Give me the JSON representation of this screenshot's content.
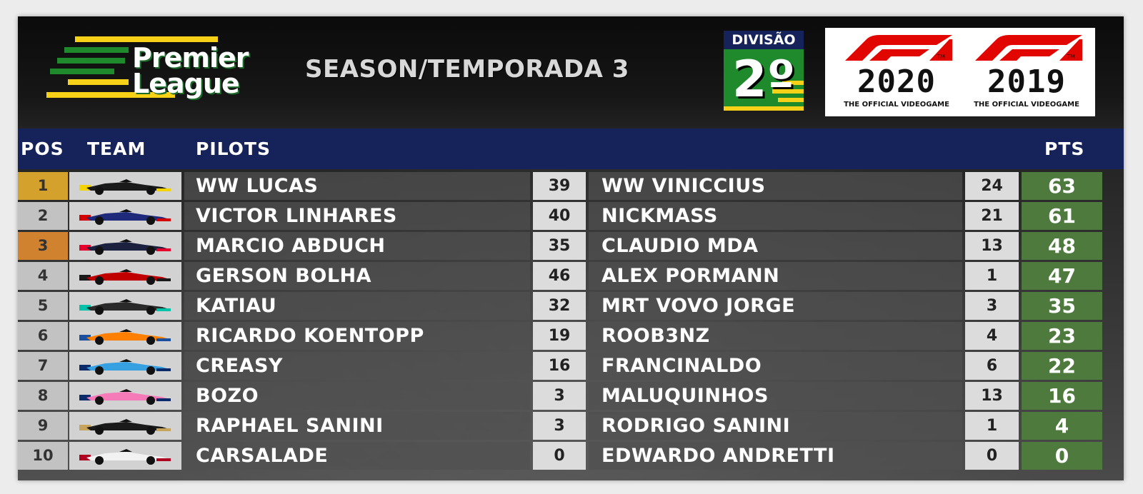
{
  "header": {
    "league_line1": "Premier",
    "league_line2": "League",
    "season_title": "SEASON/TEMPORADA 3",
    "division_label": "DIVISÃO",
    "division_value": "2º",
    "f1_logos": [
      {
        "year": "2020",
        "tagline": "THE OFFICIAL VIDEOGAME",
        "tm": "TM"
      },
      {
        "year": "2019",
        "tagline": "THE OFFICIAL VIDEOGAME",
        "tm": "TM"
      }
    ]
  },
  "columns": {
    "pos": "POS",
    "team": "TEAM",
    "pilots": "PILOTS",
    "pts": "PTS"
  },
  "colors": {
    "header_blue": "#16235a",
    "total_green": "#4f7a3e",
    "gold": "#d4a12c",
    "bronze": "#d0822f",
    "brazil_green": "#1e8a2c",
    "brazil_yellow": "#f7d117"
  },
  "standings": [
    {
      "pos": "1",
      "pos_color": "#d4a12c",
      "car": {
        "body": "#1a1a1a",
        "accent": "#f5d300"
      },
      "pilot1": "WW LUCAS",
      "pts1": "39",
      "pilot2": "WW VINICCIUS",
      "pts2": "24",
      "total": "63"
    },
    {
      "pos": "2",
      "pos_color": "#c2c2c2",
      "car": {
        "body": "#1f2a7a",
        "accent": "#d40000"
      },
      "pilot1": "VICTOR LINHARES",
      "pts1": "40",
      "pilot2": "NICKMASS",
      "pts2": "21",
      "total": "61"
    },
    {
      "pos": "3",
      "pos_color": "#d0822f",
      "car": {
        "body": "#1c2140",
        "accent": "#e8002d"
      },
      "pilot1": "MARCIO ABDUCH",
      "pts1": "35",
      "pilot2": "CLAUDIO MDA",
      "pts2": "13",
      "total": "48"
    },
    {
      "pos": "4",
      "pos_color": "#c2c2c2",
      "car": {
        "body": "#c00000",
        "accent": "#1a1a1a"
      },
      "pilot1": "GERSON BOLHA",
      "pts1": "46",
      "pilot2": "ALEX PORMANN",
      "pts2": "1",
      "total": "47"
    },
    {
      "pos": "5",
      "pos_color": "#c2c2c2",
      "car": {
        "body": "#2a2a2a",
        "accent": "#00c2a8"
      },
      "pilot1": "KATIAU",
      "pts1": "32",
      "pilot2": "MRT VOVO JORGE",
      "pts2": "3",
      "total": "35"
    },
    {
      "pos": "6",
      "pos_color": "#c2c2c2",
      "car": {
        "body": "#ff8000",
        "accent": "#1a4fa0"
      },
      "pilot1": "RICARDO KOENTOPP",
      "pts1": "19",
      "pilot2": "ROOB3NZ",
      "pts2": "4",
      "total": "23"
    },
    {
      "pos": "7",
      "pos_color": "#c2c2c2",
      "car": {
        "body": "#37a0e0",
        "accent": "#0a2a6a"
      },
      "pilot1": "CREASY",
      "pts1": "16",
      "pilot2": "FRANCINALDO",
      "pts2": "6",
      "total": "22"
    },
    {
      "pos": "8",
      "pos_color": "#c2c2c2",
      "car": {
        "body": "#f47ab8",
        "accent": "#0a2a6a"
      },
      "pilot1": "BOZO",
      "pts1": "3",
      "pilot2": "MALUQUINHOS",
      "pts2": "13",
      "total": "16"
    },
    {
      "pos": "9",
      "pos_color": "#c2c2c2",
      "car": {
        "body": "#1a1a1a",
        "accent": "#c8a45a"
      },
      "pilot1": "RAPHAEL SANINI",
      "pts1": "3",
      "pilot2": "RODRIGO SANINI",
      "pts2": "1",
      "total": "4"
    },
    {
      "pos": "10",
      "pos_color": "#c2c2c2",
      "car": {
        "body": "#f2f2f2",
        "accent": "#b00020"
      },
      "pilot1": "CARSALADE",
      "pts1": "0",
      "pilot2": "EDWARDO ANDRETTI",
      "pts2": "0",
      "total": "0"
    }
  ]
}
